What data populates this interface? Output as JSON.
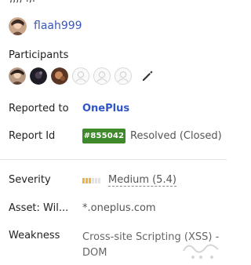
{
  "reporter": {
    "username": "flaah999"
  },
  "participants": {
    "label": "Participants",
    "edit_icon": "pencil-icon"
  },
  "reported_to": {
    "label": "Reported to",
    "team": "OnePlus"
  },
  "report_id": {
    "label": "Report Id",
    "id": "#855042",
    "state": "Resolved (Closed)",
    "badge_color": "#3e8a2a"
  },
  "severity": {
    "label": "Severity",
    "value": "Medium (5.4)",
    "level_fraction": 0.54,
    "bar_color": "#f2b33d"
  },
  "asset": {
    "label": "Asset: Wil...",
    "value": "*.oneplus.com"
  },
  "weakness": {
    "label": "Weakness",
    "value": "Cross-site Scripting (XSS) - DOM"
  },
  "colors": {
    "link": "#3b57b8",
    "team_link": "#2f55c9"
  }
}
